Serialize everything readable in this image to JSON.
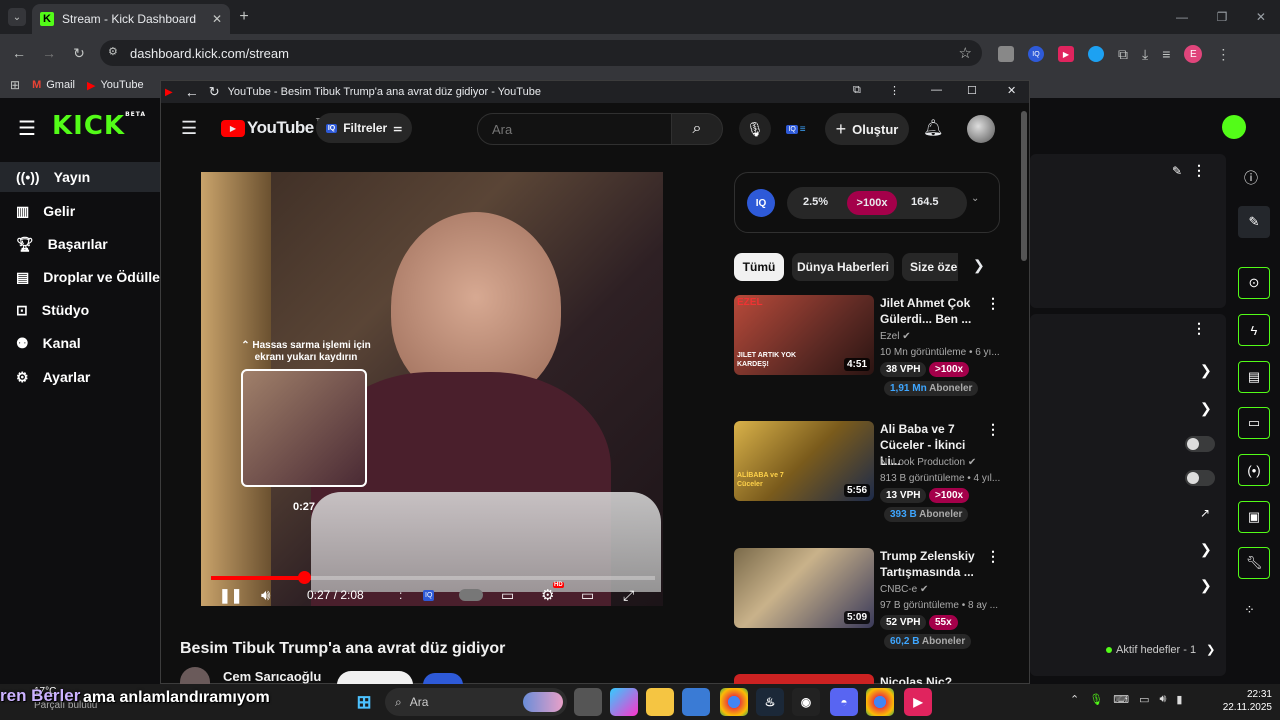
{
  "browser": {
    "tab_title": "Stream - Kick Dashboard",
    "url": "dashboard.kick.com/stream",
    "bookmarks": [
      "Gmail",
      "YouTube"
    ],
    "profile_initial": "E"
  },
  "kick": {
    "logo": "KICK",
    "logo_badge": "BETA",
    "nav": [
      {
        "label": "Yayın",
        "icon": "broadcast-icon"
      },
      {
        "label": "Gelir",
        "icon": "chart-icon"
      },
      {
        "label": "Başarılar",
        "icon": "trophy-icon"
      },
      {
        "label": "Droplar ve Ödüller",
        "icon": "drops-icon"
      },
      {
        "label": "Stüdyo",
        "icon": "studio-icon"
      },
      {
        "label": "Kanal",
        "icon": "channel-icon"
      },
      {
        "label": "Ayarlar",
        "icon": "gear-icon"
      }
    ],
    "goals_text": "Aktif hedefler - 1",
    "accent": "#53fc18"
  },
  "popup": {
    "window_title": "YouTube - Besim Tibuk Trump'a ana avrat düz gidiyor - YouTube"
  },
  "youtube": {
    "logo": "YouTube",
    "region": "TR",
    "filters_label": "Filtreler",
    "search_placeholder": "Ara",
    "create_label": "Oluştur",
    "iq": {
      "label": "IQ",
      "pct": "2.5%",
      "multiplier": ">100x",
      "score": "164.5"
    },
    "chips": [
      "Tümü",
      "Dünya Haberleri",
      "Size öze"
    ],
    "video": {
      "title": "Besim Tibuk Trump'a ana avrat düz gidiyor",
      "channel": "Cem Sarıcaoğlu",
      "time_current": "0:27",
      "time_total": "2:08",
      "progress": 0.21,
      "scrub_hint": "Hassas sarma işlemi için ekranı yukarı kaydırın",
      "preview_time": "0:27",
      "quality_badge": "HD"
    },
    "recommendations": [
      {
        "title": "Jilet Ahmet Çok Gülerdi... Ben ...",
        "channel": "Ezel",
        "views": "10 Mn görüntüleme • 6 yı...",
        "duration": "4:51",
        "vph": "38 VPH",
        "outlier": ">100x",
        "subs": "1,91 Mn",
        "subs_label": "Aboneler",
        "thumb_text": "JILET ARTIK YOK KARDEŞ!",
        "thumb_logo": "EZEL"
      },
      {
        "title": "Ali Baba ve 7 Cüceler - İkinci Li...",
        "channel": "NuLook Production",
        "views": "813 B görüntüleme • 4 yıl...",
        "duration": "5:56",
        "vph": "13 VPH",
        "outlier": ">100x",
        "subs": "393 B",
        "subs_label": "Aboneler",
        "thumb_text": "ALİBABA ve 7 Cüceler"
      },
      {
        "title": "Trump Zelenskiy Tartışmasında ...",
        "channel": "CNBC-e",
        "views": "97 B görüntüleme • 8 ay ...",
        "duration": "5:09",
        "vph": "52 VPH",
        "outlier": "55x",
        "subs": "60,2 B",
        "subs_label": "Aboneler"
      },
      {
        "title": "Nicolas Nic?...",
        "duration": ""
      }
    ]
  },
  "taskbar": {
    "weather_temp": "17°C",
    "weather_text": "Parçalı bulutlu",
    "search_placeholder": "Ara",
    "time": "22:31",
    "date": "22.11.2025",
    "overlay_text_1": "ren Berler",
    "overlay_text_2": "ama anlamlandıramıyom"
  }
}
